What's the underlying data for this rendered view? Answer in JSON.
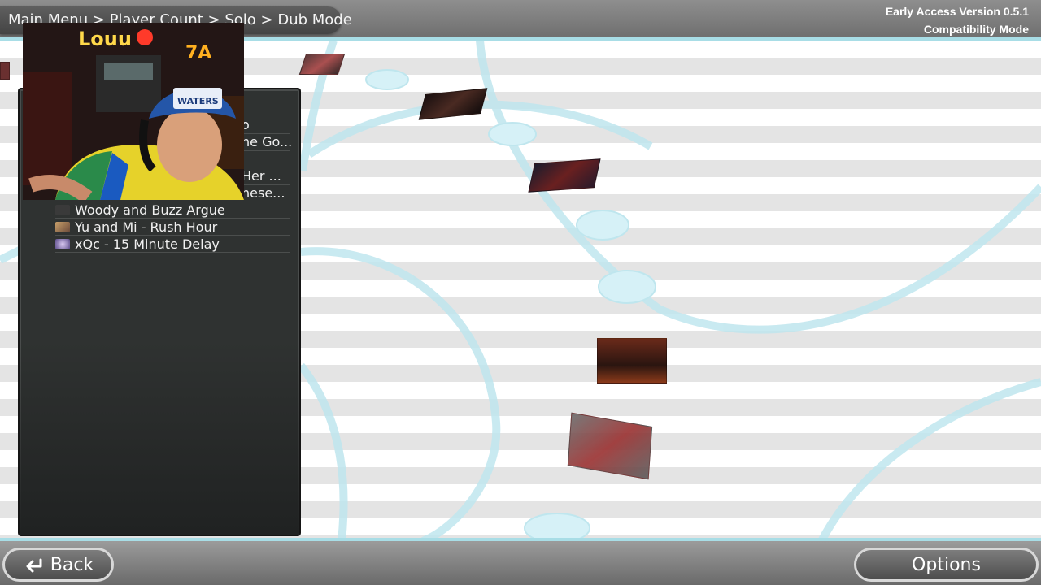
{
  "header": {
    "breadcrumb": "Main Menu > Player Count > Solo > Dub Mode",
    "version": "Early Access Version 0.5.1",
    "mode": "Compatibility Mode"
  },
  "list": {
    "partial_items": [
      "o",
      "he Go...",
      "Her ...",
      "hese..."
    ],
    "items": [
      {
        "label": "Woody and Buzz Argue",
        "thumb_color": "#3a3a3a"
      },
      {
        "label": "Yu and Mi - Rush Hour",
        "thumb_color": "#8a6a4a"
      },
      {
        "label": "xQc - 15 Minute Delay",
        "thumb_color": "#7a6aa8"
      }
    ]
  },
  "webcam": {
    "sign_left": "Louu",
    "sign_right": "7A",
    "cap_text": "WATERS"
  },
  "footer": {
    "back_label": "Back",
    "options_label": "Options"
  },
  "colors": {
    "accent": "#a8dde6",
    "stripe": "#e4e4e4",
    "panel": "#2f3231"
  }
}
